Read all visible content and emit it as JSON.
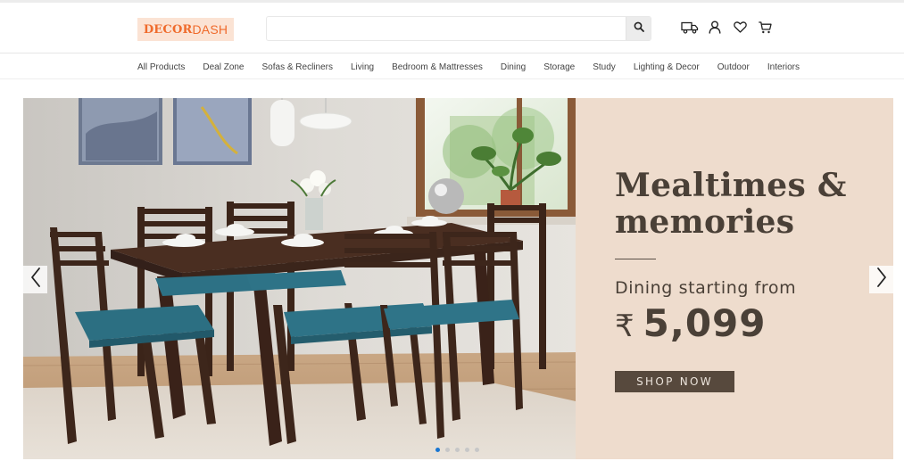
{
  "brand": {
    "logo_part1": "DECOR",
    "logo_part2": "DASH",
    "accent": "#ef6b2c"
  },
  "search": {
    "placeholder": "",
    "value": ""
  },
  "header_icons": [
    "truck-icon",
    "user-icon",
    "heart-icon",
    "cart-icon"
  ],
  "nav": {
    "items": [
      "All Products",
      "Deal Zone",
      "Sofas & Recliners",
      "Living",
      "Bedroom & Mattresses",
      "Dining",
      "Storage",
      "Study",
      "Lighting & Decor",
      "Outdoor",
      "Interiors"
    ]
  },
  "banner": {
    "title_line1": "Mealtimes &",
    "title_line2": "memories",
    "subtitle": "Dining starting from",
    "currency": "₹",
    "price": "5,099",
    "cta": "SHOP NOW",
    "slides_count": 5,
    "active_slide": 1,
    "colors": {
      "panel": "#eedccd",
      "text": "#4a4037",
      "button": "#57493d",
      "active_dot": "#1976d2"
    }
  }
}
